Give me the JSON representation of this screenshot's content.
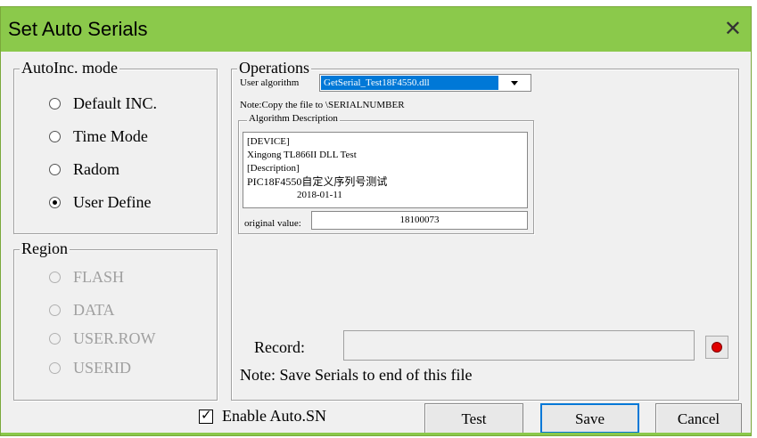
{
  "window": {
    "title": "Set Auto Serials"
  },
  "autoinc": {
    "legend": "AutoInc. mode",
    "options": [
      {
        "label": "Default INC.",
        "selected": false
      },
      {
        "label": "Time Mode",
        "selected": false
      },
      {
        "label": "Radom",
        "selected": false
      },
      {
        "label": "User Define",
        "selected": true
      }
    ]
  },
  "region": {
    "legend": "Region",
    "options": [
      {
        "label": "FLASH"
      },
      {
        "label": "DATA"
      },
      {
        "label": "USER.ROW"
      },
      {
        "label": "USERID"
      }
    ]
  },
  "operations": {
    "legend": "Operations",
    "user_algorithm_label": "User algorithm",
    "user_algorithm_value": "GetSerial_Test18F4550.dll",
    "note": "Note:Copy the file to \\SERIALNUMBER",
    "desc_legend": "Algorithm Description",
    "description_lines": [
      "[DEVICE]",
      "Xingong TL866II DLL Test",
      "[Description]",
      "PIC18F4550自定义序列号测试",
      "2018-01-11"
    ],
    "original_value_label": "original value:",
    "original_value": "18100073",
    "record_label": "Record:",
    "record_value": "",
    "record_note": "Note: Save Serials to end of this file"
  },
  "footer": {
    "enable_label": "Enable Auto.SN",
    "enable_checked": true,
    "test_label": "Test",
    "save_label": "Save",
    "cancel_label": "Cancel"
  },
  "colors": {
    "titlebar": "#8bc94b",
    "selection": "#0078d7",
    "record_dot": "#e00000"
  }
}
